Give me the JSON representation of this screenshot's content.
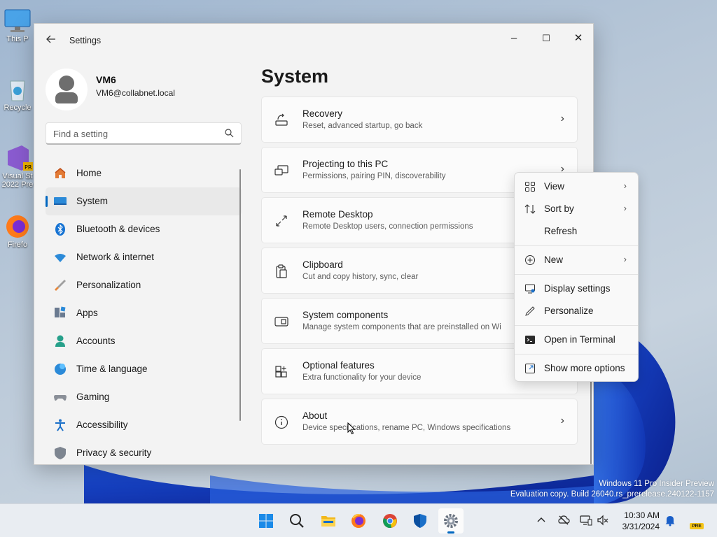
{
  "desktop": {
    "icons": [
      {
        "label": "This P",
        "icon": "monitor-icon"
      },
      {
        "label": "Recycle",
        "icon": "recycle-bin-icon"
      },
      {
        "label": "Visual St\n2022 Pre",
        "icon": "visual-studio-icon"
      },
      {
        "label": "Firefo",
        "icon": "firefox-icon"
      }
    ],
    "watermark": {
      "line1": "Windows 11 Pro Insider Preview",
      "line2": "Evaluation copy. Build 26040.rs_prerelease.240122-1157"
    }
  },
  "window": {
    "title": "Settings",
    "controls": {
      "minimize": "–",
      "maximize": "☐",
      "close": "✕"
    },
    "profile": {
      "name": "VM6",
      "email": "VM6@collabnet.local"
    },
    "search": {
      "placeholder": "Find a setting"
    },
    "nav": [
      {
        "label": "Home",
        "icon": "home-icon",
        "active": false
      },
      {
        "label": "System",
        "icon": "system-icon",
        "active": true
      },
      {
        "label": "Bluetooth & devices",
        "icon": "bluetooth-icon",
        "active": false
      },
      {
        "label": "Network & internet",
        "icon": "wifi-icon",
        "active": false
      },
      {
        "label": "Personalization",
        "icon": "brush-icon",
        "active": false
      },
      {
        "label": "Apps",
        "icon": "apps-icon",
        "active": false
      },
      {
        "label": "Accounts",
        "icon": "account-icon",
        "active": false
      },
      {
        "label": "Time & language",
        "icon": "globe-clock-icon",
        "active": false
      },
      {
        "label": "Gaming",
        "icon": "gamepad-icon",
        "active": false
      },
      {
        "label": "Accessibility",
        "icon": "accessibility-icon",
        "active": false
      },
      {
        "label": "Privacy & security",
        "icon": "shield-icon",
        "active": false
      }
    ],
    "page_title": "System",
    "cards": [
      {
        "title": "Recovery",
        "subtitle": "Reset, advanced startup, go back",
        "icon": "recovery-icon"
      },
      {
        "title": "Projecting to this PC",
        "subtitle": "Permissions, pairing PIN, discoverability",
        "icon": "projecting-icon"
      },
      {
        "title": "Remote Desktop",
        "subtitle": "Remote Desktop users, connection permissions",
        "icon": "remote-desktop-icon"
      },
      {
        "title": "Clipboard",
        "subtitle": "Cut and copy history, sync, clear",
        "icon": "clipboard-icon"
      },
      {
        "title": "System components",
        "subtitle": "Manage system components that are preinstalled on Wi",
        "icon": "system-components-icon"
      },
      {
        "title": "Optional features",
        "subtitle": "Extra functionality for your device",
        "icon": "optional-features-icon"
      },
      {
        "title": "About",
        "subtitle": "Device specifications, rename PC, Windows specifications",
        "icon": "info-icon"
      }
    ]
  },
  "context_menu": {
    "items": [
      {
        "label": "View",
        "icon": "view-grid-icon",
        "submenu": true
      },
      {
        "label": "Sort by",
        "icon": "sort-icon",
        "submenu": true
      },
      {
        "label": "Refresh",
        "icon": "refresh-icon",
        "submenu": false
      },
      {
        "label": "New",
        "icon": "new-plus-icon",
        "submenu": true
      },
      {
        "label": "Display settings",
        "icon": "display-settings-icon",
        "submenu": false
      },
      {
        "label": "Personalize",
        "icon": "personalize-pen-icon",
        "submenu": false
      },
      {
        "label": "Open in Terminal",
        "icon": "terminal-icon",
        "submenu": false
      },
      {
        "label": "Show more options",
        "icon": "show-more-icon",
        "submenu": false
      }
    ],
    "submenu_arrow": "›"
  },
  "taskbar": {
    "apps": [
      "start-icon",
      "search-icon",
      "file-explorer-icon",
      "firefox-icon",
      "chrome-icon",
      "defender-icon",
      "settings-icon"
    ],
    "clock": {
      "time": "10:30 AM",
      "date": "3/31/2024"
    },
    "badge": "PRE"
  },
  "colors": {
    "accent": "#0067c0"
  }
}
